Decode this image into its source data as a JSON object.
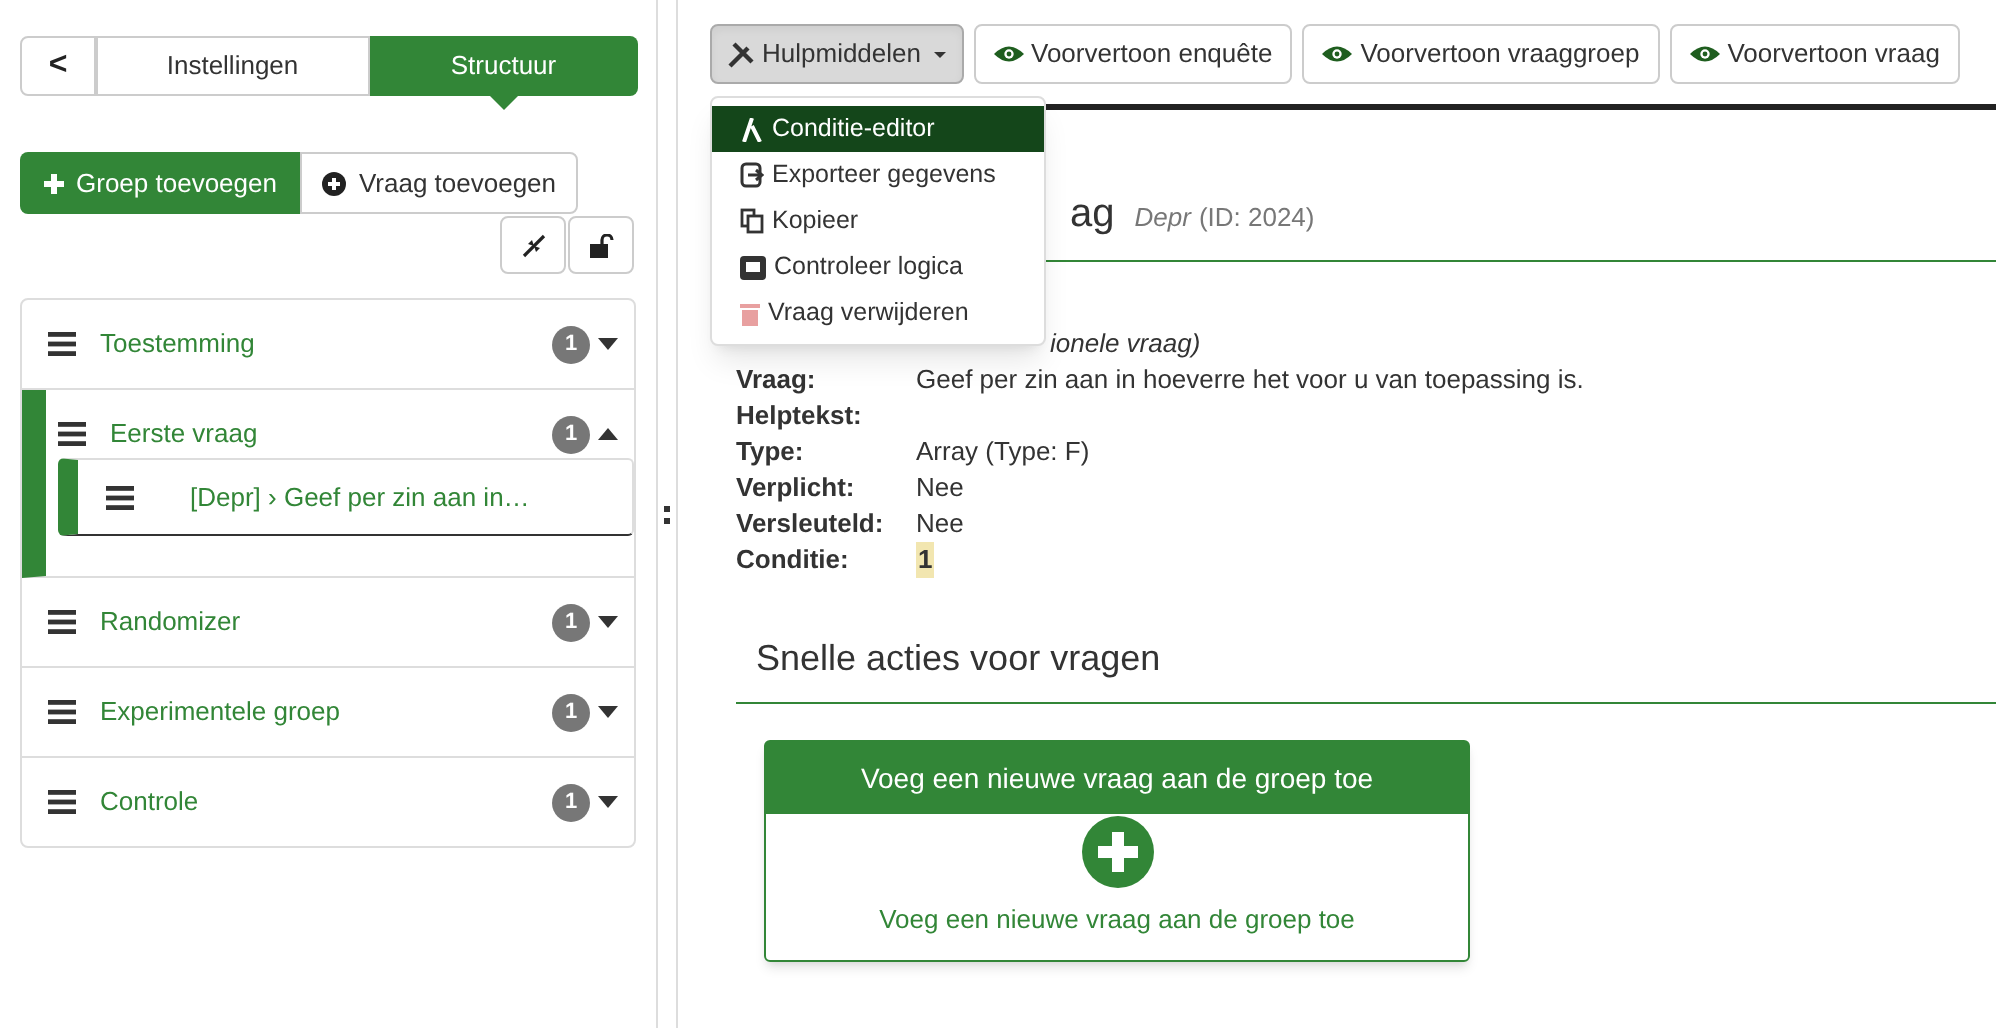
{
  "sidebar": {
    "back_label": "<",
    "tabs": [
      {
        "label": "Instellingen",
        "selected": false
      },
      {
        "label": "Structuur",
        "selected": true
      }
    ],
    "add_group": "Groep toevoegen",
    "add_question": "Vraag toevoegen",
    "groups": [
      {
        "name": "Toestemming",
        "count": "1",
        "expanded": false,
        "selected": false
      },
      {
        "name": "Eerste vraag",
        "count": "1",
        "expanded": true,
        "selected": true,
        "children": [
          {
            "text": "[Depr] › Geef per zin aan in…",
            "selected": true
          }
        ]
      },
      {
        "name": "Randomizer",
        "count": "1",
        "expanded": false,
        "selected": false
      },
      {
        "name": "Experimentele groep",
        "count": "1",
        "expanded": false,
        "selected": false
      },
      {
        "name": "Controle",
        "count": "1",
        "expanded": false,
        "selected": false
      }
    ]
  },
  "toolbar": {
    "tools_button": "Hulpmiddelen",
    "preview_buttons": [
      "Voorvertoon enquête",
      "Voorvertoon vraaggroep",
      "Voorvertoon vraag"
    ]
  },
  "tools_menu": [
    {
      "kind": "condition",
      "label": "Conditie-editor",
      "selected": true
    },
    {
      "kind": "export",
      "label": "Exporteer gegevens",
      "selected": false
    },
    {
      "kind": "copy",
      "label": "Kopieer",
      "selected": false
    },
    {
      "kind": "qa",
      "label": "Controleer logica",
      "selected": false
    },
    {
      "kind": "delete",
      "label": "Vraag verwijderen",
      "selected": false
    }
  ],
  "question": {
    "title_fragment": "ag",
    "code": "Depr",
    "id": "(ID: 2024)",
    "partial_value": "ionele vraag)",
    "fields": [
      {
        "label": "Vraag:",
        "value": "Geef per zin aan in hoeverre het voor u van toepassing is."
      },
      {
        "label": "Helptekst:"
      },
      {
        "label": "Type:",
        "value": "Array (Type: F)"
      },
      {
        "label": "Verplicht:",
        "value": "Nee"
      },
      {
        "label": "Versleuteld:",
        "value": "Nee"
      },
      {
        "label": "Conditie:",
        "value": "1",
        "kind": "highlight"
      }
    ]
  },
  "quick_actions": {
    "heading": "Snelle acties voor vragen",
    "card_title": "Voeg een nieuwe vraag aan de groep toe",
    "card_link": "Voeg een nieuwe vraag aan de groep toe"
  }
}
